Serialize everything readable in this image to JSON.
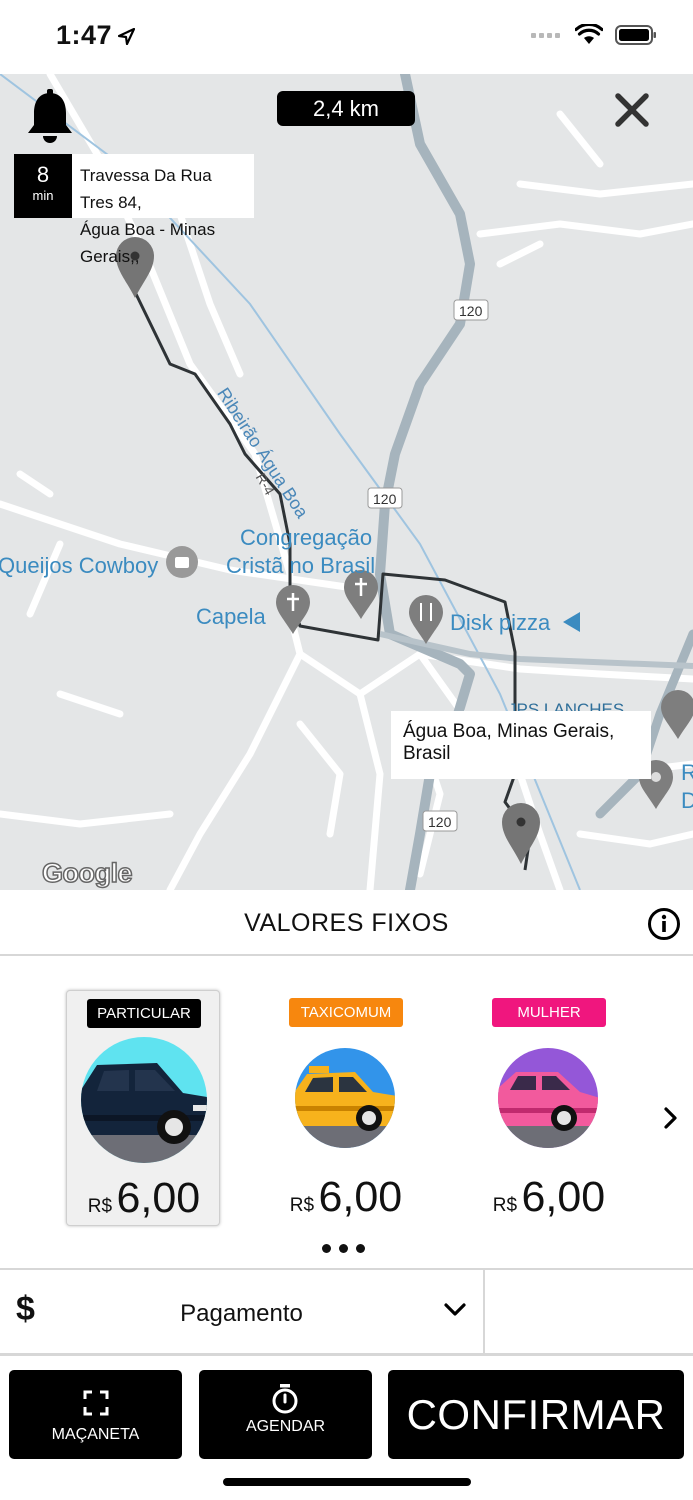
{
  "status_bar": {
    "time": "1:47",
    "icons": [
      "location-arrow-icon",
      "signal-icon",
      "wifi-icon",
      "battery-icon"
    ]
  },
  "map": {
    "distance": "2,4 km",
    "origin": {
      "eta_value": "8",
      "eta_unit": "min",
      "address_line1": "Travessa Da Rua Tres 84,",
      "address_line2": "Água Boa - Minas Gerais,,"
    },
    "destination": {
      "address": "Água Boa, Minas Gerais, Brasil"
    },
    "labels": {
      "river": "Ribeirão Água Boa",
      "road_r4": "R-4",
      "route_120": "120",
      "poi_congregacao_1": "Congregação",
      "poi_congregacao_2": "Cristã no Brasil",
      "poi_queijos": "Queijos Cowboy",
      "poi_capela": "Capela",
      "poi_disk_pizza": "Disk pizza",
      "poi_lanches": "JPS LANCHES",
      "poi_edge_1": "R",
      "poi_edge_2": "D",
      "google": "Google"
    }
  },
  "panel": {
    "title": "VALORES FIXOS",
    "categories": [
      {
        "label": "PARTICULAR",
        "badge_color": "#000000",
        "currency": "R$",
        "price": "6,00",
        "selected": true
      },
      {
        "label": "TAXICOMUM",
        "badge_color": "#f7870e",
        "currency": "R$",
        "price": "6,00",
        "selected": false
      },
      {
        "label": "MULHER",
        "badge_color": "#f0167e",
        "currency": "R$",
        "price": "6,00",
        "selected": false
      }
    ]
  },
  "payment": {
    "label": "Pagamento",
    "icon": "dollar-icon"
  },
  "buttons": {
    "handle_label": "MAÇANETA",
    "schedule_label": "AGENDAR",
    "confirm_label": "CONFIRMAR"
  },
  "colors": {
    "map_bg": "#e4e6e7",
    "highway": "#a6b4bd",
    "river": "#9fc4e0",
    "route": "#2e3336",
    "taxi": "#f7870e",
    "mulher": "#f0167e"
  }
}
